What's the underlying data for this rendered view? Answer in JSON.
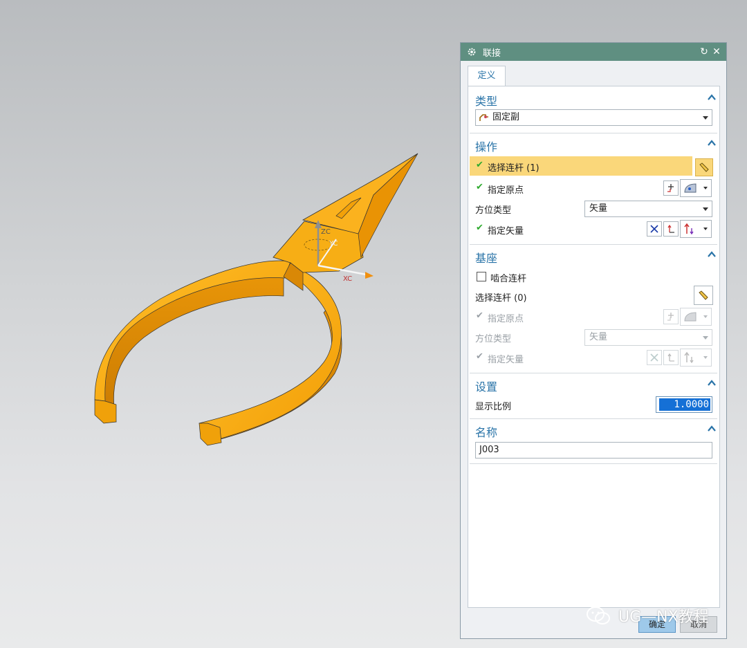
{
  "viewport": {
    "axis_labels": {
      "zc": "ZC",
      "yc": "YC",
      "xc": "XC"
    },
    "model_color": "#f5a40c"
  },
  "dialog": {
    "title": "联接",
    "tab": "定义",
    "sections": {
      "type": {
        "label": "类型",
        "select_value": "固定副"
      },
      "action": {
        "label": "操作",
        "select_link": "选择连杆 (1)",
        "specify_origin": "指定原点",
        "orientation_type_label": "方位类型",
        "orientation_type_value": "矢量",
        "specify_vector": "指定矢量"
      },
      "base": {
        "label": "基座",
        "snap_link": "啮合连杆",
        "select_link": "选择连杆 (0)",
        "specify_origin": "指定原点",
        "orientation_type_label": "方位类型",
        "orientation_type_value": "矢量",
        "specify_vector": "指定矢量"
      },
      "settings": {
        "label": "设置",
        "display_scale_label": "显示比例",
        "display_scale_value": "1.0000"
      },
      "name": {
        "label": "名称",
        "value": "J003"
      }
    },
    "ok_label": "确定",
    "cancel_label": "取消"
  },
  "watermark": "UG—NX教程",
  "colors": {
    "titlebar": "#5f8f81",
    "section_label": "#2a74a8",
    "highlight": "#fad77a",
    "check": "#2eaa2e",
    "selected_field": "#1570d6"
  }
}
